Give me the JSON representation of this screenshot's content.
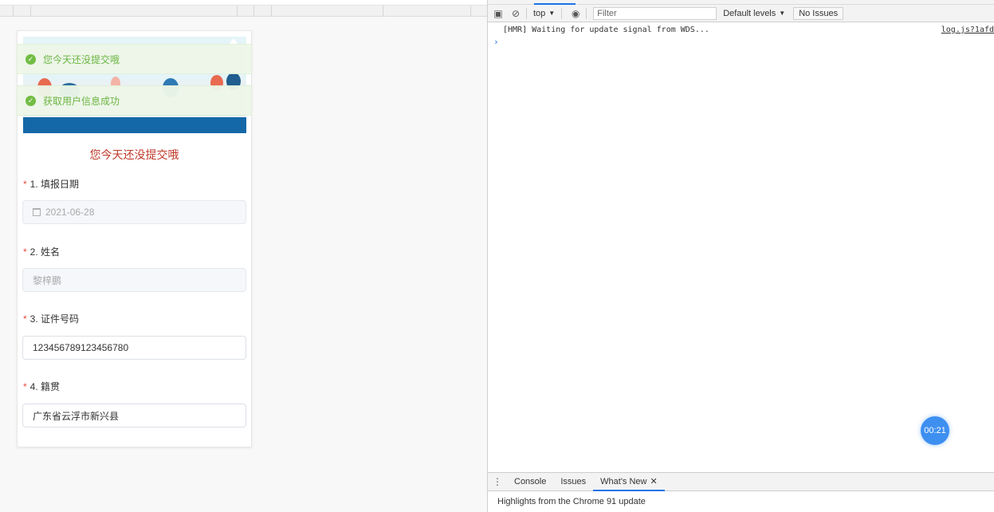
{
  "form": {
    "toasts": [
      {
        "text": "您今天还没提交哦"
      },
      {
        "text": "获取用户信息成功"
      }
    ],
    "notice": "您今天还没提交哦",
    "questions": [
      {
        "label": "1. 填报日期",
        "value": "2021-06-28",
        "disabled": true
      },
      {
        "label": "2. 姓名",
        "value": "黎梓鹏",
        "disabled": true
      },
      {
        "label": "3. 证件号码",
        "value": "123456789123456780",
        "disabled": false
      },
      {
        "label": "4. 籍贯",
        "value": "广东省云浮市新兴县",
        "disabled": false
      }
    ],
    "required_mark": "*"
  },
  "devtools": {
    "toolbar": {
      "context": "top",
      "filter_placeholder": "Filter",
      "levels": "Default levels",
      "issues": "No Issues"
    },
    "console": {
      "log_text": "[HMR] Waiting for update signal from WDS...",
      "log_source": "log.js?1afd",
      "prompt": "›"
    },
    "drawer": {
      "tabs": [
        "Console",
        "Issues",
        "What's New"
      ],
      "active_tab": "What's New",
      "body": "Highlights from the Chrome 91 update"
    }
  },
  "timer": "00:21",
  "colors": {
    "accent": "#1a73e8",
    "success": "#68b33b",
    "notice": "#c0392b",
    "timer": "#3d8ff0"
  }
}
